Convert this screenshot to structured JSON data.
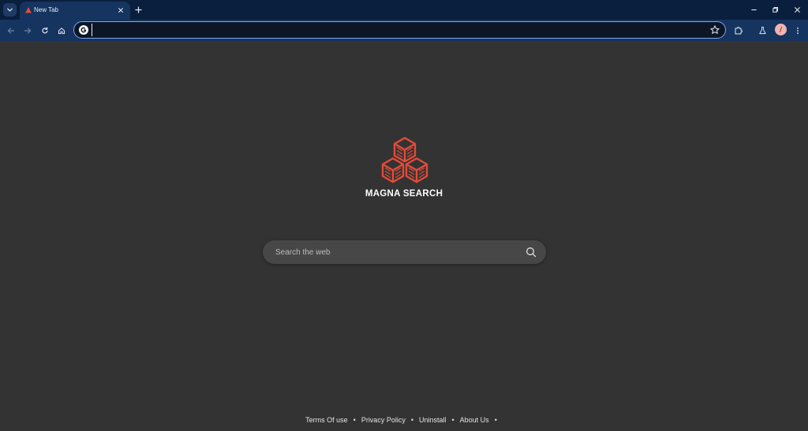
{
  "browser": {
    "tab": {
      "title": "New Tab"
    },
    "omnibox": {
      "value": "",
      "placeholder": ""
    }
  },
  "page": {
    "brand_name": "MAGNA SEARCH",
    "search": {
      "placeholder": "Search the web"
    },
    "footer_links": [
      {
        "label": "Terms Of use"
      },
      {
        "label": "Privacy Policy"
      },
      {
        "label": "Uninstall"
      },
      {
        "label": "About Us"
      }
    ],
    "footer_separator": "•"
  },
  "colors": {
    "tabstrip_bg": "#0a1f3d",
    "toolbar_bg": "#15345f",
    "omnibox_border": "#7ea7f0",
    "page_bg": "#333333",
    "search_bg": "#474747",
    "logo_accent": "#e44b3a"
  },
  "icons": {
    "tab_search": "chevron-down-icon",
    "tab_favicon": "magna-favicon",
    "tab_close": "close-icon",
    "new_tab": "plus-icon",
    "window_minimize": "minimize-icon",
    "window_restore": "restore-icon",
    "window_close": "close-icon",
    "back": "back-arrow-icon",
    "forward": "forward-arrow-icon",
    "reload": "reload-icon",
    "home": "home-icon",
    "omnibox_engine": "google-g-icon",
    "bookmark": "star-icon",
    "extensions": "puzzle-icon",
    "labs": "flask-icon",
    "menu": "kebab-menu-icon",
    "search": "search-icon"
  }
}
